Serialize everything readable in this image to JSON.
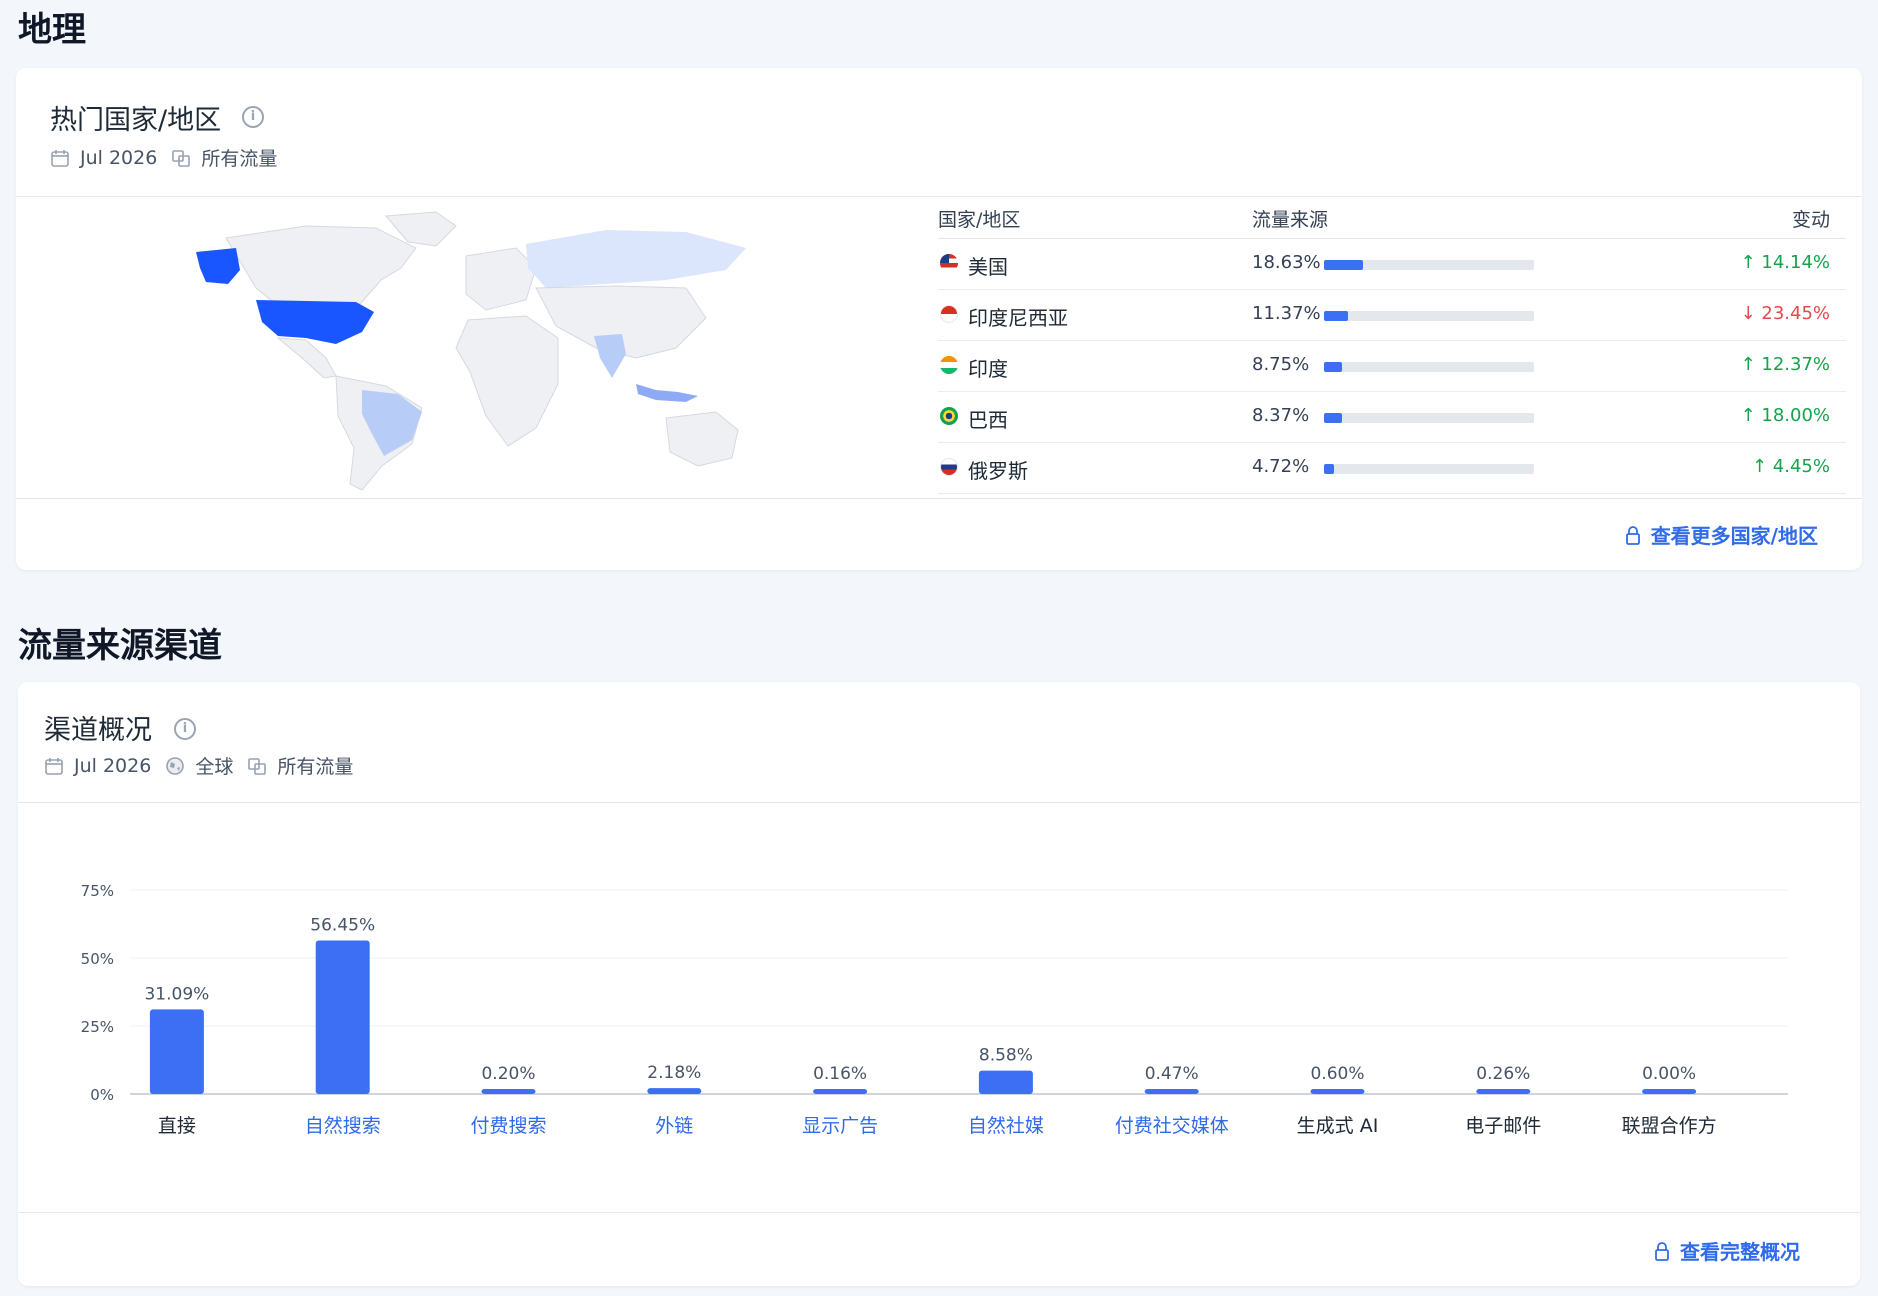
{
  "geo": {
    "section_title": "地理",
    "card_title": "热门国家/地区",
    "info": "i",
    "date": "Jul 2026",
    "traffic_filter": "所有流量",
    "columns": {
      "country": "国家/地区",
      "traffic": "流量来源",
      "change": "变动"
    },
    "rows": [
      {
        "country": "美国",
        "share": "18.63%",
        "share_value": 18.63,
        "change": "↑ 14.14%",
        "direction": "up"
      },
      {
        "country": "印度尼西亚",
        "share": "11.37%",
        "share_value": 11.37,
        "change": "↓ 23.45%",
        "direction": "down"
      },
      {
        "country": "印度",
        "share": "8.75%",
        "share_value": 8.75,
        "change": "↑ 12.37%",
        "direction": "up"
      },
      {
        "country": "巴西",
        "share": "8.37%",
        "share_value": 8.37,
        "change": "↑ 18.00%",
        "direction": "up"
      },
      {
        "country": "俄罗斯",
        "share": "4.72%",
        "share_value": 4.72,
        "change": "↑ 4.45%",
        "direction": "up"
      }
    ],
    "more_link": "查看更多国家/地区"
  },
  "channels": {
    "section_title": "流量来源渠道",
    "card_title": "渠道概况",
    "info": "i",
    "date": "Jul 2026",
    "region": "全球",
    "traffic_filter": "所有流量",
    "more_link": "查看完整概况"
  },
  "chart_data": {
    "type": "bar",
    "categories": [
      "直接",
      "自然搜索",
      "付费搜索",
      "外链",
      "显示广告",
      "自然社媒",
      "付费社交媒体",
      "生成式 AI",
      "电子邮件",
      "联盟合作方"
    ],
    "values": [
      31.09,
      56.45,
      0.2,
      2.18,
      0.16,
      8.58,
      0.47,
      0.6,
      0.26,
      0.0
    ],
    "value_labels": [
      "31.09%",
      "56.45%",
      "0.20%",
      "2.18%",
      "0.16%",
      "8.58%",
      "0.47%",
      "0.60%",
      "0.26%",
      "0.00%"
    ],
    "linked_categories": [
      false,
      true,
      true,
      true,
      true,
      true,
      true,
      false,
      false,
      false
    ],
    "y_ticks": [
      "0%",
      "25%",
      "50%",
      "75%"
    ],
    "ylim": [
      0,
      75
    ],
    "grid": true,
    "colors": {
      "bar": "#3d6ff5",
      "link": "#2f6bea",
      "axis_text": "#475467"
    }
  }
}
